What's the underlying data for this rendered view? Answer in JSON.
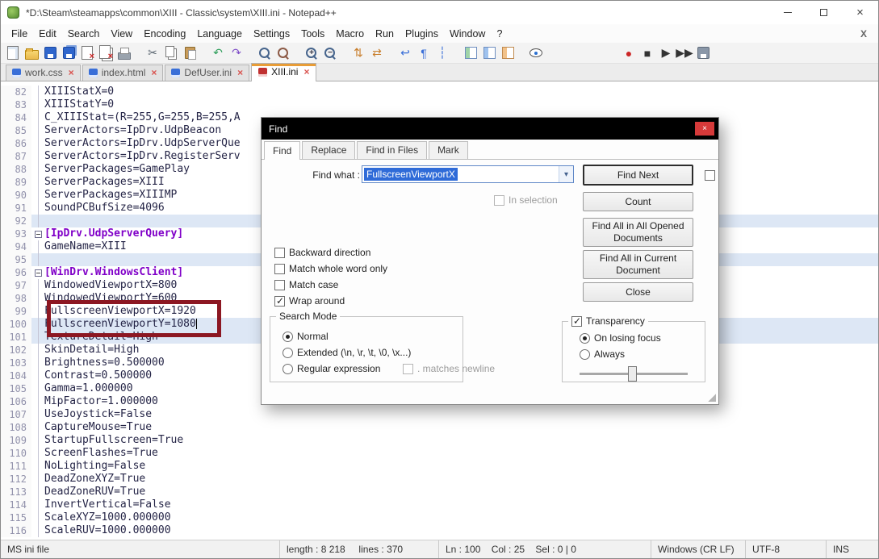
{
  "colors": {
    "section_text": "#8000c8",
    "body_text": "#242446",
    "line_number": "#9191ab",
    "highlight_line": "#dde7f5",
    "annotation_border": "#8c1722",
    "active_tab_accent": "#e89c36",
    "selection_bg": "#2f6bd8",
    "dialog_title_bg": "#000000",
    "dialog_close_btn": "#d63a3a"
  },
  "window": {
    "title": "*D:\\Steam\\steamapps\\common\\XIII - Classic\\system\\XIII.ini - Notepad++",
    "controls": [
      "minimize",
      "maximize",
      "close"
    ]
  },
  "menu": {
    "items": [
      "File",
      "Edit",
      "Search",
      "View",
      "Encoding",
      "Language",
      "Settings",
      "Tools",
      "Macro",
      "Run",
      "Plugins",
      "Window",
      "?"
    ],
    "close_button": "X"
  },
  "toolbar": {
    "icons": [
      {
        "name": "new-file",
        "shape": "page"
      },
      {
        "name": "open-file",
        "shape": "folder"
      },
      {
        "name": "save",
        "shape": "floppy"
      },
      {
        "name": "save-all",
        "shape": "floppy2"
      },
      {
        "name": "close-file",
        "shape": "pagex"
      },
      {
        "name": "close-all-files",
        "shape": "pagexx"
      },
      {
        "name": "print",
        "shape": "printer"
      },
      {
        "name": "cut",
        "glyph": "✂",
        "color": "#5a6570",
        "gap": true
      },
      {
        "name": "copy",
        "shape": "copy"
      },
      {
        "name": "paste",
        "shape": "paste"
      },
      {
        "name": "undo",
        "glyph": "↶",
        "color": "#2e9e5b",
        "gap": true
      },
      {
        "name": "redo",
        "glyph": "↷",
        "color": "#8050c8"
      },
      {
        "name": "find",
        "shape": "mag",
        "gap": true
      },
      {
        "name": "replace",
        "shape": "mag2"
      },
      {
        "name": "zoom-in",
        "shape": "mag",
        "char": "+",
        "gap": true
      },
      {
        "name": "zoom-out",
        "shape": "mag",
        "char": "−"
      },
      {
        "name": "sync-vertical-scroll",
        "glyph": "⇅",
        "color": "#c87d2a",
        "gap": true
      },
      {
        "name": "sync-horizontal-scroll",
        "glyph": "⇄",
        "color": "#c87d2a"
      },
      {
        "name": "word-wrap",
        "glyph": "↩",
        "color": "#3a6fd8",
        "gap": true
      },
      {
        "name": "show-all-characters",
        "glyph": "¶",
        "color": "#3a6fd8"
      },
      {
        "name": "show-indent-guide",
        "glyph": "┆",
        "color": "#3a6fd8"
      },
      {
        "name": "function-list",
        "shape": "panel-g",
        "gap": true
      },
      {
        "name": "document-map",
        "shape": "panel-b"
      },
      {
        "name": "document-switcher",
        "shape": "panel-o"
      },
      {
        "name": "monitoring",
        "shape": "eye",
        "gap": true
      },
      {
        "name": "record-macro",
        "glyph": "●",
        "color": "#cc2626",
        "biggap": true
      },
      {
        "name": "stop-macro",
        "glyph": "■",
        "color": "#333333"
      },
      {
        "name": "play-macro",
        "glyph": "▶",
        "color": "#333333"
      },
      {
        "name": "run-macro-multiple",
        "glyph": "▶▶",
        "color": "#333333"
      },
      {
        "name": "save-macro",
        "shape": "floppy-gray"
      }
    ]
  },
  "tabs": [
    {
      "label": "work.css",
      "active": false,
      "modified": false
    },
    {
      "label": "index.html",
      "active": false,
      "modified": false
    },
    {
      "label": "DefUser.ini",
      "active": false,
      "modified": false
    },
    {
      "label": "XIII.ini",
      "active": true,
      "modified": true
    }
  ],
  "editor": {
    "lines": [
      {
        "n": 82,
        "t": "XIIIStatX=0",
        "y": "kv",
        "inFold": true
      },
      {
        "n": 83,
        "t": "XIIIStatY=0",
        "y": "kv",
        "inFold": true
      },
      {
        "n": 84,
        "t": "C_XIIIStat=(R=255,G=255,B=255,A",
        "y": "kv",
        "inFold": true
      },
      {
        "n": 85,
        "t": "ServerActors=IpDrv.UdpBeacon",
        "y": "kv",
        "inFold": true
      },
      {
        "n": 86,
        "t": "ServerActors=IpDrv.UdpServerQue",
        "y": "kv",
        "inFold": true
      },
      {
        "n": 87,
        "t": "ServerActors=IpDrv.RegisterServ",
        "y": "kv",
        "inFold": true
      },
      {
        "n": 88,
        "t": "ServerPackages=GamePlay",
        "y": "kv",
        "inFold": true
      },
      {
        "n": 89,
        "t": "ServerPackages=XIII",
        "y": "kv",
        "inFold": true
      },
      {
        "n": 90,
        "t": "ServerPackages=XIIIMP",
        "y": "kv",
        "inFold": true
      },
      {
        "n": 91,
        "t": "SoundPCBufSize=4096",
        "y": "kv",
        "inFold": true
      },
      {
        "n": 92,
        "t": "",
        "y": "blank",
        "hl": true,
        "inFold": true
      },
      {
        "n": 93,
        "t": "[IpDrv.UdpServerQuery]",
        "y": "section",
        "fold": true
      },
      {
        "n": 94,
        "t": "GameName=XIII",
        "y": "kv",
        "inFold": true
      },
      {
        "n": 95,
        "t": "",
        "y": "blank",
        "hl": true,
        "inFold": true
      },
      {
        "n": 96,
        "t": "[WinDrv.WindowsClient]",
        "y": "section",
        "fold": true
      },
      {
        "n": 97,
        "t": "WindowedViewportX=800",
        "y": "kv",
        "inFold": true
      },
      {
        "n": 98,
        "t": "WindowedViewportY=600",
        "y": "kv",
        "inFold": true
      },
      {
        "n": 99,
        "t": "FullscreenViewportX=1920",
        "y": "kv",
        "inFold": true
      },
      {
        "n": 100,
        "t": "FullscreenViewportY=1080",
        "y": "kv",
        "hl": true,
        "inFold": true,
        "caret": true
      },
      {
        "n": 101,
        "t": "TextureDetail=High",
        "y": "kv",
        "hl": true,
        "inFold": true
      },
      {
        "n": 102,
        "t": "SkinDetail=High",
        "y": "kv",
        "inFold": true
      },
      {
        "n": 103,
        "t": "Brightness=0.500000",
        "y": "kv",
        "inFold": true
      },
      {
        "n": 104,
        "t": "Contrast=0.500000",
        "y": "kv",
        "inFold": true
      },
      {
        "n": 105,
        "t": "Gamma=1.000000",
        "y": "kv",
        "inFold": true
      },
      {
        "n": 106,
        "t": "MipFactor=1.000000",
        "y": "kv",
        "inFold": true
      },
      {
        "n": 107,
        "t": "UseJoystick=False",
        "y": "kv",
        "inFold": true
      },
      {
        "n": 108,
        "t": "CaptureMouse=True",
        "y": "kv",
        "inFold": true
      },
      {
        "n": 109,
        "t": "StartupFullscreen=True",
        "y": "kv",
        "inFold": true
      },
      {
        "n": 110,
        "t": "ScreenFlashes=True",
        "y": "kv",
        "inFold": true
      },
      {
        "n": 111,
        "t": "NoLighting=False",
        "y": "kv",
        "inFold": true
      },
      {
        "n": 112,
        "t": "DeadZoneXYZ=True",
        "y": "kv",
        "inFold": true
      },
      {
        "n": 113,
        "t": "DeadZoneRUV=True",
        "y": "kv",
        "inFold": true
      },
      {
        "n": 114,
        "t": "InvertVertical=False",
        "y": "kv",
        "inFold": true
      },
      {
        "n": 115,
        "t": "ScaleXYZ=1000.000000",
        "y": "kv",
        "inFold": true
      },
      {
        "n": 116,
        "t": "ScaleRUV=1000.000000",
        "y": "kv",
        "inFold": true
      }
    ]
  },
  "find_dialog": {
    "title": "Find",
    "tabs": [
      {
        "label": "Find",
        "active": true
      },
      {
        "label": "Replace",
        "active": false
      },
      {
        "label": "Find in Files",
        "active": false
      },
      {
        "label": "Mark",
        "active": false
      }
    ],
    "find_what": {
      "label": "Find what :",
      "value": "FullscreenViewportX"
    },
    "find_next_label": "Find Next",
    "two_buttons_mode": {
      "checked": false
    },
    "count_label": "Count",
    "find_all_opened_label": "Find All in All Opened Documents",
    "find_all_current_label": "Find All in Current Document",
    "close_label": "Close",
    "in_selection": {
      "label": "In selection",
      "checked": false
    },
    "backward_direction": {
      "label": "Backward direction",
      "checked": false
    },
    "whole_word": {
      "label": "Match whole word only",
      "checked": false
    },
    "match_case": {
      "label": "Match case",
      "checked": false
    },
    "wrap_around": {
      "label": "Wrap around",
      "checked": true
    },
    "search_mode": {
      "title": "Search Mode",
      "normal": {
        "label": "Normal",
        "selected": true
      },
      "extended": {
        "label": "Extended (\\n, \\r, \\t, \\0, \\x...)",
        "selected": false
      },
      "regex": {
        "label": "Regular expression",
        "selected": false
      },
      "matches_newline": {
        "label": ". matches newline",
        "checked": false
      }
    },
    "transparency": {
      "label": "Transparency",
      "checked": true,
      "on_losing_focus": {
        "label": "On losing focus",
        "selected": true
      },
      "always": {
        "label": "Always",
        "selected": false
      },
      "slider_percent": 45
    }
  },
  "status_bar": {
    "left": "MS ini file",
    "segments": [
      {
        "name": "length-lines",
        "text": "length : 8 218     lines : 370"
      },
      {
        "name": "cursor-position",
        "text": "Ln : 100    Col : 25    Sel : 0 | 0"
      },
      {
        "name": "eol-format",
        "text": "Windows (CR LF)"
      },
      {
        "name": "encoding",
        "text": "UTF-8"
      },
      {
        "name": "insert-mode",
        "text": "INS"
      }
    ]
  }
}
